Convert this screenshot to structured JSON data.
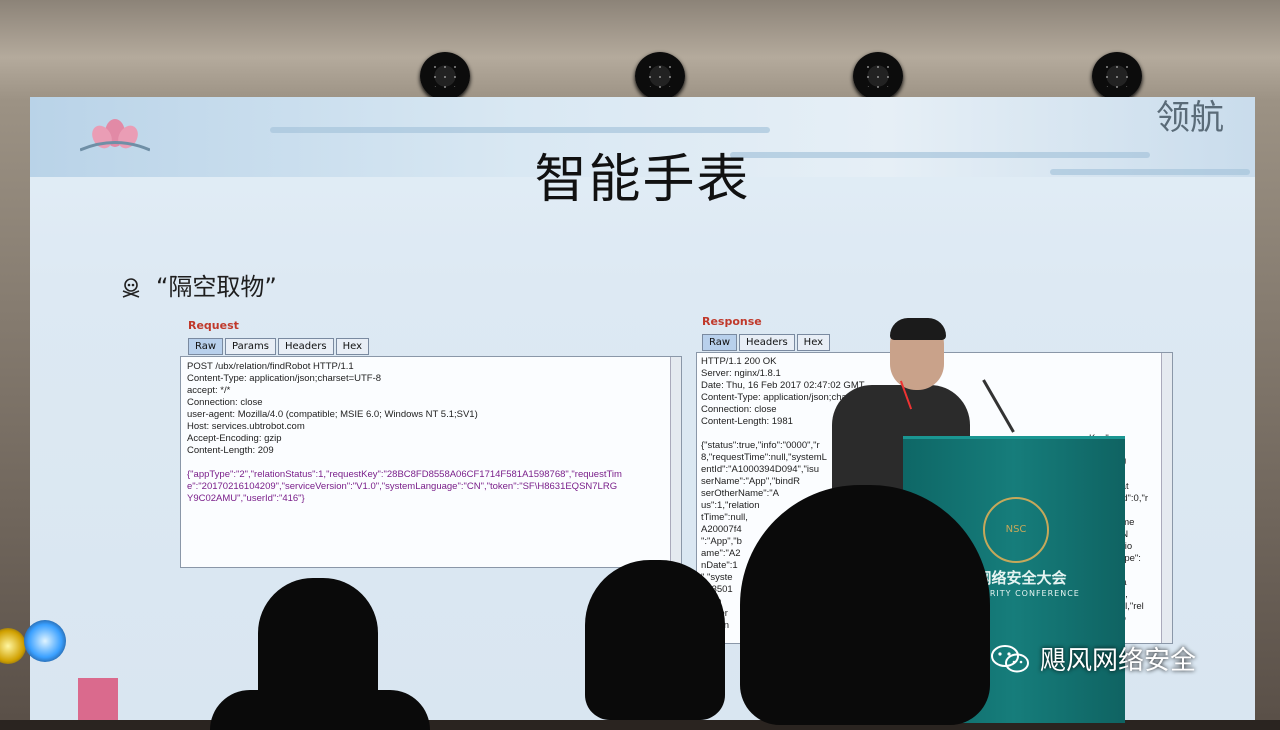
{
  "slide": {
    "title": "智能手表",
    "seal_text": "领航",
    "bullet": "“隔空取物”"
  },
  "request_panel": {
    "label": "Request",
    "tabs": [
      "Raw",
      "Params",
      "Headers",
      "Hex"
    ],
    "lines": [
      "POST /ubx/relation/findRobot HTTP/1.1",
      "Content-Type: application/json;charset=UTF-8",
      "accept: */*",
      "Connection: close",
      "user-agent: Mozilla/4.0 (compatible; MSIE 6.0; Windows NT 5.1;SV1)",
      "Host: services.ubtrobot.com",
      "Accept-Encoding: gzip",
      "Content-Length: 209"
    ],
    "json_lines": [
      "{\"appType\":\"2\",\"relationStatus\":1,\"requestKey\":\"28BC8FD8558A06CF1714F581A1598768\",\"requestTim",
      "e\":\"20170216104209\",\"serviceVersion\":\"V1.0\",\"systemLanguage\":\"CN\",\"token\":\"SF\\H8631EQSN7LRG",
      "Y9C02AMU\",\"userId\":\"416\"}"
    ]
  },
  "response_panel": {
    "label": "Response",
    "tabs": [
      "Raw",
      "Headers",
      "Hex"
    ],
    "lines": [
      "HTTP/1.1 200 OK",
      "Server: nginx/1.8.1",
      "Date: Thu, 16 Feb 2017 02:47:02 GMT",
      "Content-Type: application/json;char",
      "Connection: close",
      "Content-Length: 1981"
    ],
    "json_lines": [
      "{\"status\":true,\"info\":\"0000\",\"r",
      "8,\"requestTime\":null,\"systemL",
      "entId\":\"A1000394D094\",\"isu",
      "serName\":\"App\",\"bindR",
      "serOtherName\":\"A",
      "us\":1,\"relation",
      "tTime\":null,",
      "A20007f4",
      "\":\"App\",\"b",
      "ame\":\"A2",
      "nDate\":1",
      "\",\"syste",
      "813501",
      "\"App",
      "rOther",
      "UserIn"
    ],
    "right_fragments": [
      "Key\":nu",
      "\"equipm",
      "pp\",\"upU",
      "0094\",\"u",
      "lationStat",
      "upUserId\":0,\"r",
      "mentId\":",
      "UserName",
      "erOtherN",
      "\":1,\"relatio",
      "ystemType\":",
      "\"T20160",
      "pUserNa",
      "19E473\",",
      "mail\":null,\"rel",
      "trobot.co"
    ]
  },
  "podium": {
    "emblem": "NSC",
    "title_cn": "国网络安全大会",
    "title_en": "ER SECURITY CONFERENCE"
  },
  "watermark": {
    "text": "飓风网络安全",
    "icon": "wechat-icon"
  }
}
